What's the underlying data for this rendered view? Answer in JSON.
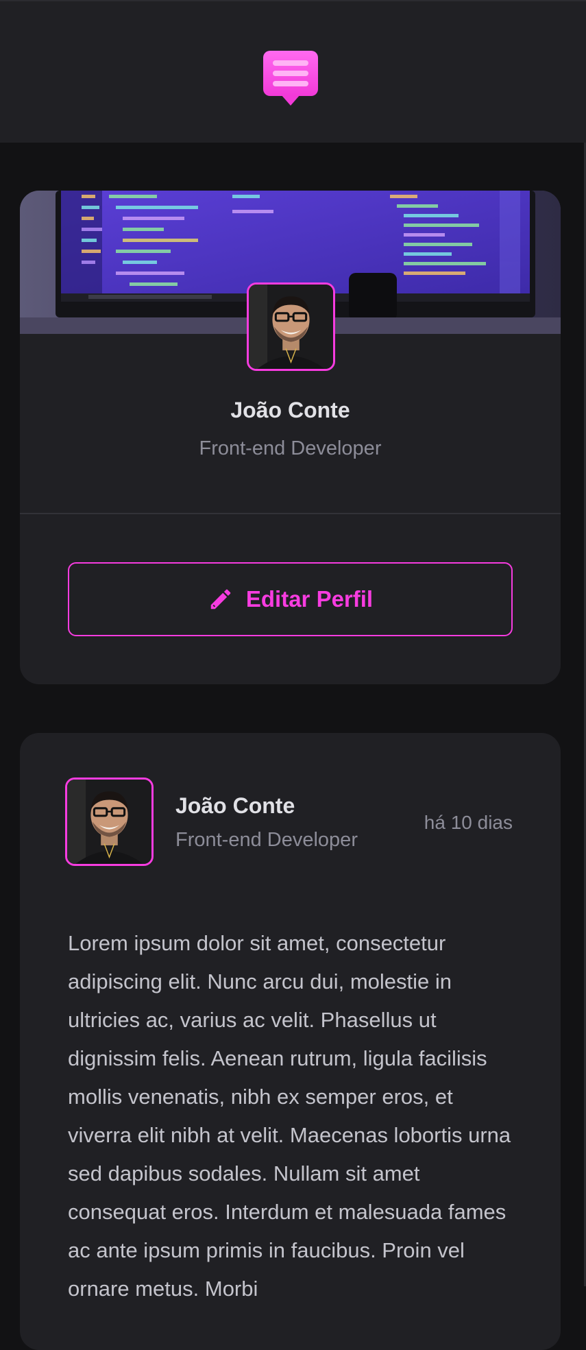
{
  "header": {
    "logo_icon": "chat-bubble-list-icon"
  },
  "profile_card": {
    "cover_image": "code-editor-monitor-photo",
    "avatar": "user-avatar-photo",
    "name": "João Conte",
    "role": "Front-end Developer",
    "edit_button": {
      "icon": "pencil-icon",
      "label": "Editar Perfil"
    }
  },
  "post": {
    "avatar": "user-avatar-photo",
    "author": "João Conte",
    "role": "Front-end Developer",
    "time": "há 10 dias",
    "body": "Lorem ipsum dolor sit amet, consectetur adipiscing elit. Nunc arcu dui, molestie in ultricies ac, varius ac velit. Phasellus ut dignissim felis. Aenean rutrum, ligula facilisis mollis venenatis, nibh ex semper eros, et viverra elit nibh at velit. Maecenas lobortis urna sed dapibus sodales. Nullam sit amet consequat eros. Interdum et malesuada fames ac ante ipsum primis in faucibus. Proin vel ornare metus. Morbi"
  },
  "colors": {
    "accent": "#f73ce0",
    "background": "#121214",
    "card": "#202024",
    "text_primary": "#e1e1e6",
    "text_secondary": "#8d8d99"
  }
}
